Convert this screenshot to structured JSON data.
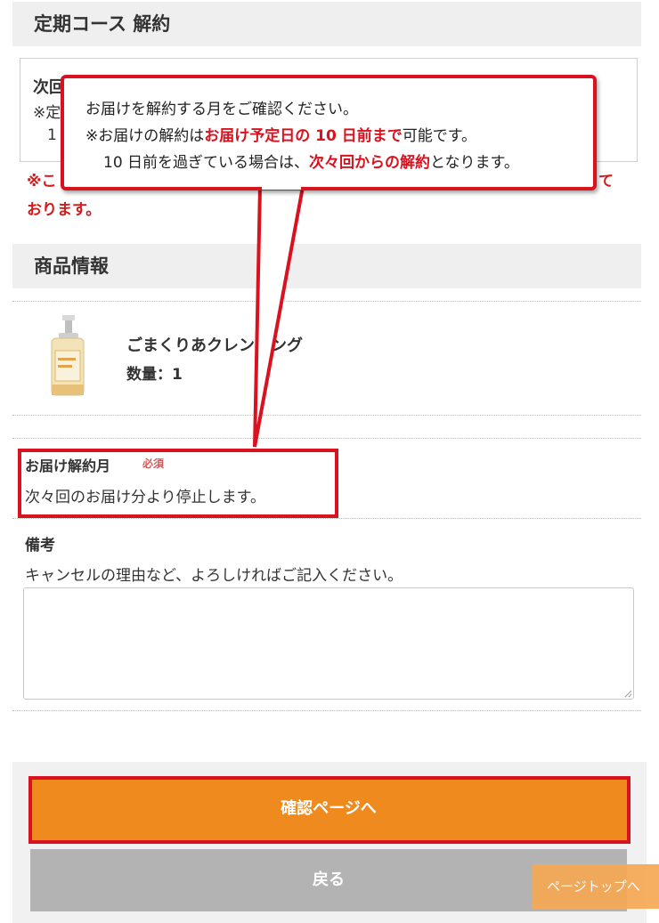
{
  "course_header": {
    "title": "定期コース 解約"
  },
  "course_box": {
    "line1": "次回",
    "line2": "※定",
    "line3": "1"
  },
  "notice": {
    "line1_start": "※こ",
    "line1_end": "て",
    "line2": "おります。"
  },
  "callout": {
    "line1": "お届けを解約する月をご確認ください。",
    "line2_pre": "※お届けの解約は",
    "line2_emph": "お届け予定日の 10 日前まで",
    "line2_post": "可能です。",
    "line3_pre": "10 日前を過ぎている場合は、",
    "line3_emph": "次々回からの解約",
    "line3_post": "となります。"
  },
  "product_section": {
    "title": "商品情報"
  },
  "product": {
    "name": "ごまくりあクレンジング",
    "quantity": "数量：1"
  },
  "delivery": {
    "label": "お届け解約月",
    "required": "必須",
    "value": "次々回のお届け分より停止します。"
  },
  "remarks": {
    "label": "備考",
    "help": "キャンセルの理由など、よろしければご記入ください。",
    "value": ""
  },
  "buttons": {
    "confirm": "確認ページへ",
    "back": "戻る",
    "page_top": "ページトップへ"
  },
  "colors": {
    "accent_orange": "#ef8a1f",
    "highlight_red": "#d8121f",
    "button_gray": "#b3b3b3"
  }
}
